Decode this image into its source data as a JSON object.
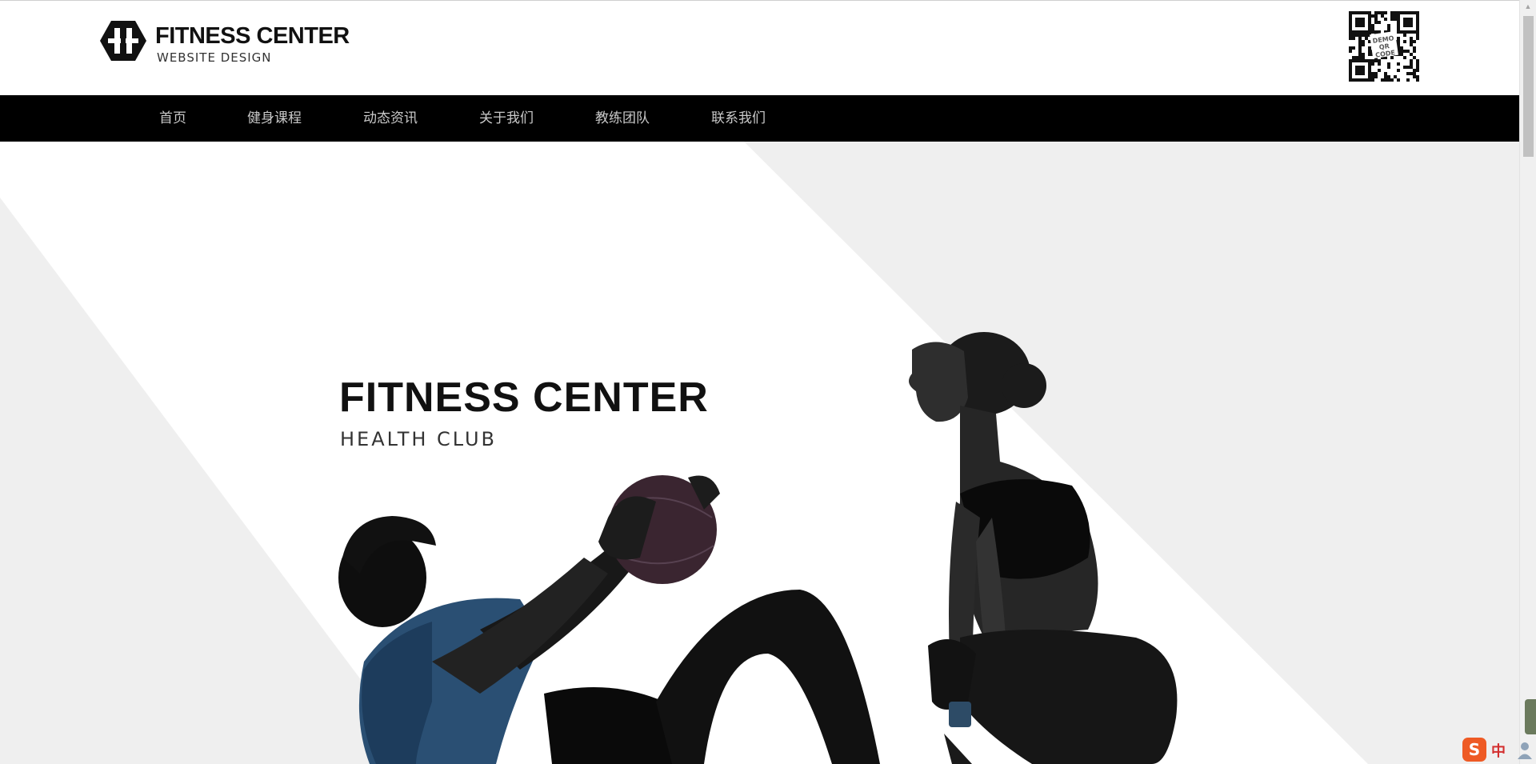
{
  "header": {
    "logo_title": "FITNESS CENTER",
    "logo_subtitle": "WEBSITE DESIGN",
    "qr_text": "DEMO QR CODE"
  },
  "nav": {
    "items": [
      {
        "label": "首页"
      },
      {
        "label": "健身课程"
      },
      {
        "label": "动态资讯"
      },
      {
        "label": "关于我们"
      },
      {
        "label": "教练团队"
      },
      {
        "label": "联系我们"
      }
    ]
  },
  "hero": {
    "title": "FITNESS CENTER",
    "subtitle": "HEALTH CLUB"
  },
  "ime": {
    "logo": "S",
    "language": "中"
  },
  "colors": {
    "nav_background": "#000000",
    "nav_text": "#c9c9c9",
    "hero_panel": "#efefef",
    "ime_orange": "#ee5a24"
  }
}
